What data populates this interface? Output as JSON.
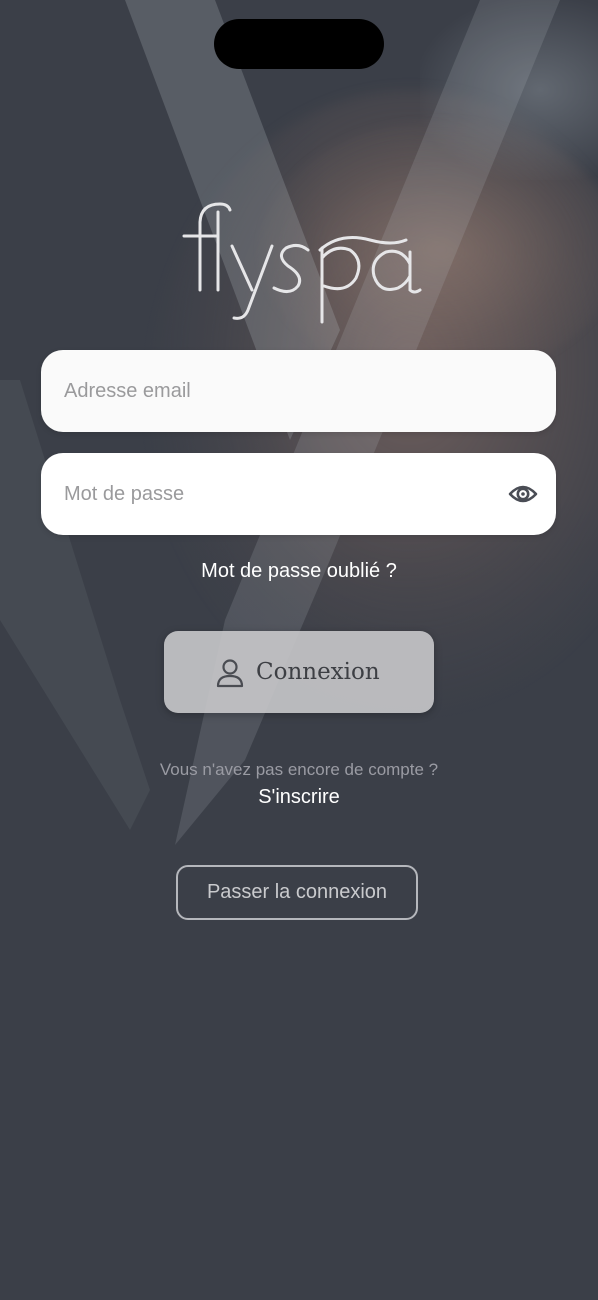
{
  "app": {
    "logo_text": "flyspa"
  },
  "form": {
    "email_placeholder": "Adresse email",
    "password_placeholder": "Mot de passe",
    "forgot_password": "Mot de passe oublié ?",
    "login_button": "Connexion"
  },
  "signup": {
    "prompt": "Vous n'avez pas encore de compte ?",
    "link": "S'inscrire"
  },
  "skip": {
    "label": "Passer la connexion"
  },
  "icons": {
    "password_toggle": "eye-icon",
    "login": "user-icon"
  },
  "colors": {
    "background": "#3b3f48",
    "input_bg": "#fafafa",
    "login_button_bg": "#c8c8ca",
    "login_text": "#3d3f44",
    "placeholder": "#9a9a9c",
    "muted_text": "#9a9ba3",
    "skip_border": "#b5b7bc"
  }
}
